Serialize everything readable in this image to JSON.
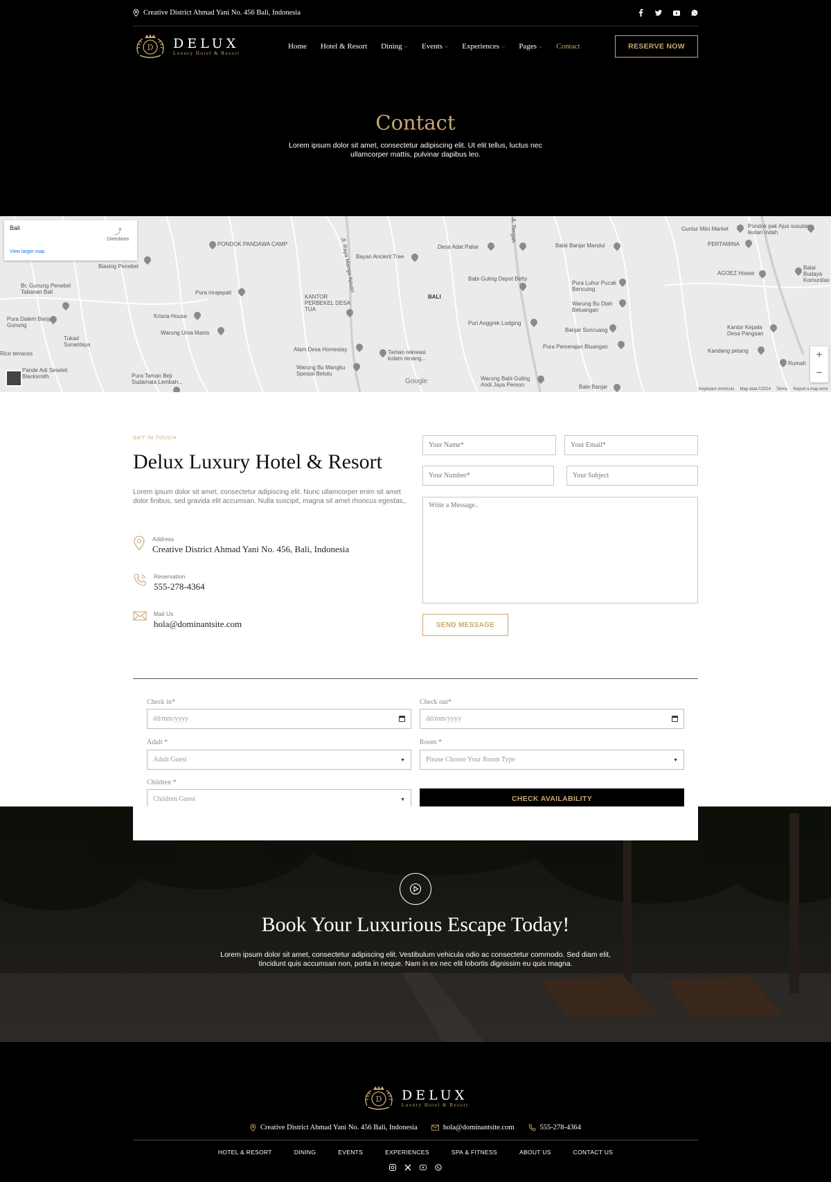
{
  "topbar": {
    "address": "Creative District Ahmad Yani No. 456 Bali, Indonesia",
    "socials": [
      "facebook-icon",
      "twitter-icon",
      "youtube-icon",
      "whatsapp-icon"
    ]
  },
  "brand": {
    "name": "DELUX",
    "tagline": "Luxury Hotel & Resort",
    "monogram": "D"
  },
  "nav": {
    "items": [
      {
        "label": "Home",
        "dropdown": false
      },
      {
        "label": "Hotel & Resort",
        "dropdown": false
      },
      {
        "label": "Dining",
        "dropdown": true
      },
      {
        "label": "Events",
        "dropdown": true
      },
      {
        "label": "Experiences",
        "dropdown": true
      },
      {
        "label": "Pages",
        "dropdown": true
      },
      {
        "label": "Contact",
        "dropdown": false,
        "active": true
      }
    ],
    "cta": "RESERVE NOW"
  },
  "hero": {
    "title": "Contact",
    "description": "Lorem ipsum dolor sit amet, consectetur adipiscing elit. Ut elit tellus, luctus nec ullamcorper mattis, pulvinar dapibus leo."
  },
  "map": {
    "place": "Bali",
    "directions": "Directions",
    "larger_map": "View larger map",
    "google": "Google",
    "footer": [
      "Keyboard shortcuts",
      "Map data ©2024",
      "Terms",
      "Report a map error"
    ],
    "labels": [
      "PONDOK PANDAWA CAMP",
      "Bayan Ancient Tree",
      "Desa Adat Paliar",
      "Balai Banjar Mandul",
      "Guntur Mini Market",
      "Pondok pak Ajus susutan lestari indah",
      "PERTAMINA",
      "Balai Budaya Komunitas",
      "AGOEZ Hoese",
      "Br. Gunung Penebel Tabanan Bali",
      "Pura mrajepati",
      "KANTOR PERBEKEL DESA TUA",
      "BALI",
      "Babi Guling Depot Betty",
      "Pura Luhur Pucak Bencuing",
      "Warung Bu Diah Beluangan",
      "Pura Dalem Banjar Gunung",
      "Krisna House",
      "Warung Uma Manis",
      "Puri Anggrek Lodging",
      "Banjar Suncuang",
      "Kantor Kepala Desa Pangsan",
      "Tukad Sunantaya",
      "Alam Desa Homestay",
      "Taman rekreasi kolam renang...",
      "Pura Pemerajan Bluangan",
      "Kandang petang",
      "Rice terraces",
      "Pande Adi Seselet Blacksmith",
      "Warung Bu Mangku Spesial Betutu",
      "Pura Taman Beji Sudamala Lembah...",
      "Warung Babi Guling Andi Jaya Pereon",
      "Bale Banjar",
      "Rumah",
      "Biasing Penebel",
      "Jl. Raya Manga Apuan",
      "Jl. Tengah"
    ]
  },
  "contact": {
    "eyebrow": "GET IN TOUCH",
    "title": "Delux Luxury Hotel & Resort",
    "description": "Lorem ipsum dolor sit amet, consectetur adipiscing elit. Nunc ullamcorper enim sit amet dolor finibus, sed gravida elit accumsan. Nulla suscipit, magna sit amet rhoncus egestas,.",
    "address_label": "Address",
    "address": "Creative District Ahmad Yani No. 456, Bali, Indonesia",
    "reservation_label": "Reservation",
    "reservation": "555-278-4364",
    "mail_label": "Mail Us",
    "mail": "hola@dominantsite.com"
  },
  "form": {
    "name_ph": "Your Name*",
    "email_ph": "Your Email*",
    "number_ph": "Your Number*",
    "subject_ph": "Your Subject",
    "message_ph": "Write a Message..",
    "send": "SEND MESSAGE"
  },
  "booking": {
    "checkin_label": "Check in*",
    "checkin_value": "dd/mm/yyyy",
    "checkout_label": "Check out*",
    "checkout_value": "dd/mm/yyyy",
    "adult_label": "Adult *",
    "adult_value": "Adult Guest",
    "room_label": "Room *",
    "room_value": "Please Choose Your Room Type",
    "children_label": "Children *",
    "children_value": "Children Guest",
    "check_btn": "CHECK AVAILABILITY"
  },
  "cta": {
    "title": "Book Your Luxurious Escape Today!",
    "description": "Lorem ipsum dolor sit amet, consectetur adipiscing elit. Vestibulum vehicula odio ac consectetur commodo. Sed diam elit, tincidunt quis accumsan non, porta in neque. Nam in ex nec elit lobortis dignissim eu quis magna."
  },
  "footer": {
    "address": "Creative District Ahmad Yani No. 456 Bali, Indonesia",
    "email": "hola@dominantsite.com",
    "phone": "555-278-4364",
    "links": [
      "HOTEL & RESORT",
      "DINING",
      "EVENTS",
      "EXPERIENCES",
      "SPA & FITNESS",
      "ABOUT US",
      "CONTACT US"
    ],
    "socials": [
      "instagram-icon",
      "x-icon",
      "youtube-icon",
      "whatsapp-icon"
    ]
  },
  "colors": {
    "accent": "#c9a772",
    "background": "#000000",
    "surface": "#ffffff"
  }
}
